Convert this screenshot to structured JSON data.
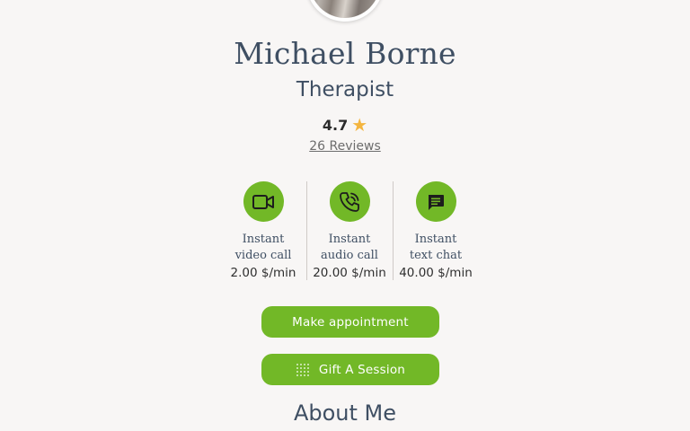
{
  "profile": {
    "name": "Michael Borne",
    "role": "Therapist",
    "rating": "4.7",
    "reviews_link": "26 Reviews"
  },
  "services": [
    {
      "icon": "video-camera-icon",
      "line1": "Instant",
      "line2": "video call",
      "price": "2.00 $/min"
    },
    {
      "icon": "phone-call-icon",
      "line1": "Instant",
      "line2": "audio call",
      "price": "20.00 $/min"
    },
    {
      "icon": "chat-bubble-icon",
      "line1": "Instant",
      "line2": "text chat",
      "price": "40.00 $/min"
    }
  ],
  "actions": {
    "appointment_label": "Make appointment",
    "gift_label": "Gift A Session"
  },
  "section": {
    "about_title": "About Me"
  },
  "colors": {
    "accent": "#72b827",
    "star": "#f4b53f",
    "heading": "#3f4f63",
    "background": "#f8f6f5"
  }
}
